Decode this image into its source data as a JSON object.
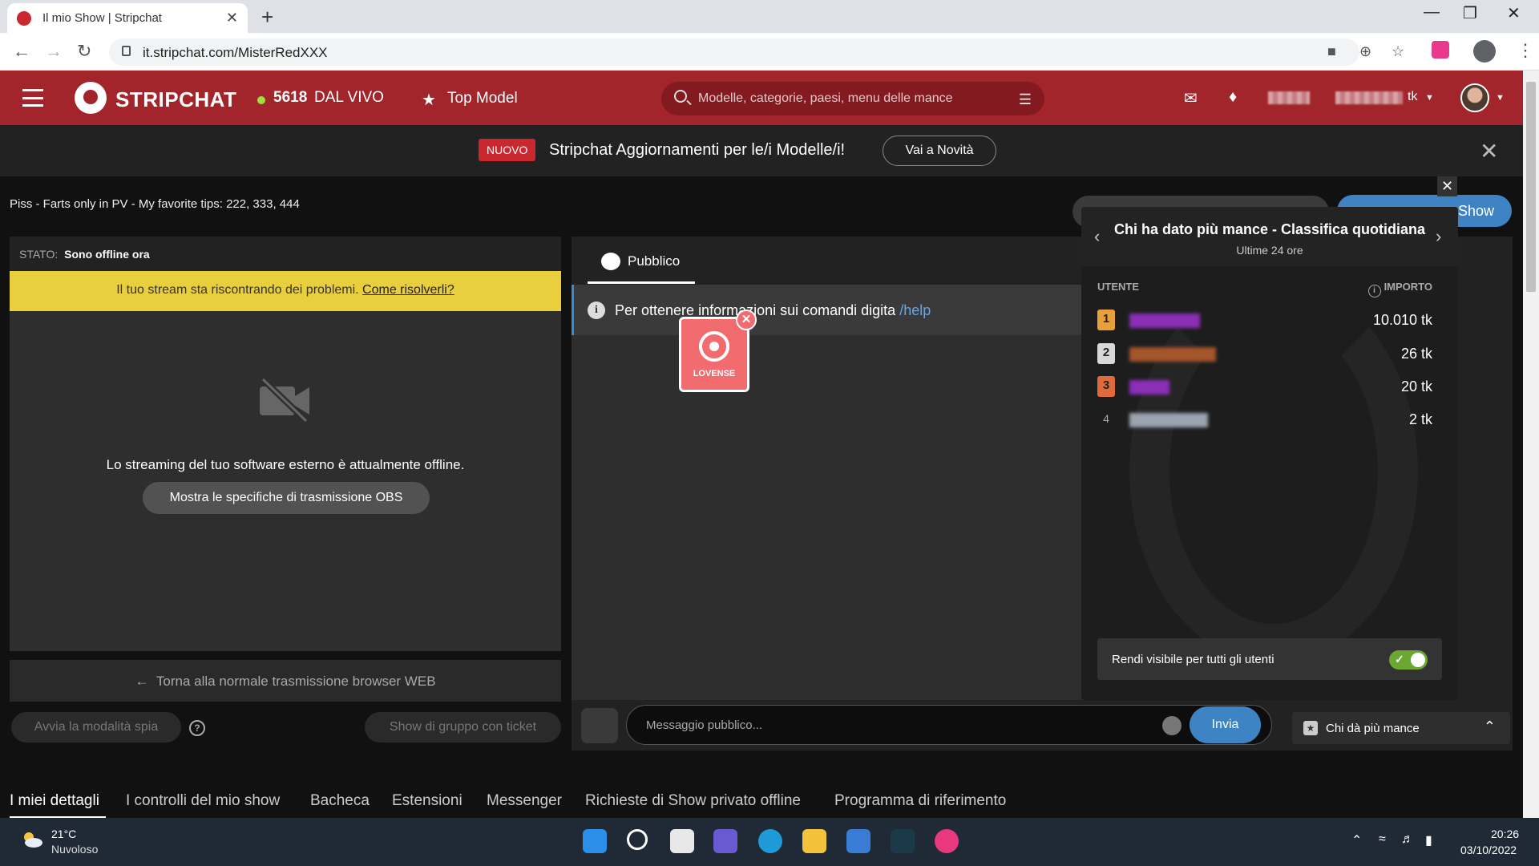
{
  "browser": {
    "tab_title": "Il mio Show | Stripchat",
    "url": "it.stripchat.com/MisterRedXXX",
    "new_tab_glyph": "+",
    "close_glyph": "✕"
  },
  "header": {
    "brand": "STRIPCHAT",
    "live_count": "5618",
    "live_label": "DAL VIVO",
    "top_model": "Top Model",
    "search_placeholder": "Modelle, categorie, paesi, menu delle mance",
    "token_suffix": "tk",
    "icons": [
      "menu-icon",
      "chat-icon",
      "bell-icon",
      "filter-icon",
      "search-icon"
    ]
  },
  "announcement": {
    "badge": "NUOVO",
    "text": "Stripchat Aggiornamenti per le/i Modelle/i!",
    "button": "Vai a Novità"
  },
  "stream": {
    "topic": "Piss - Farts only in PV - My favorite tips: 222, 333, 444",
    "status_key": "STATO:",
    "status_value": "Sono offline ora",
    "warning_text": "Il tuo stream sta riscontrando dei problemi.",
    "warning_link": "Come risolverli?",
    "offline_message": "Lo streaming del tuo software esterno è attualmente offline.",
    "obs_button": "Mostra le specifiche di trasmissione OBS",
    "back_button": "Torna alla normale trasmissione browser WEB",
    "spy_button": "Avvia la modalità spia",
    "group_button": "Show di gruppo con ticket"
  },
  "chat": {
    "tab_label": "Pubblico",
    "info_text": "Per ottenere informazioni sui comandi digita",
    "info_command": "/help",
    "lovense_label": "LOVENSE",
    "input_placeholder": "Messaggio pubblico...",
    "send_button": "Invia"
  },
  "right": {
    "show_button": "Show",
    "tippers_footer": "Chi dà più mance"
  },
  "leaderboard": {
    "title": "Chi ha dato più mance - Classifica quotidiana",
    "subtitle": "Ultime 24 ore",
    "col_user": "UTENTE",
    "col_amount": "IMPORTO",
    "rows": [
      {
        "rank": "1",
        "amount": "10.010 tk",
        "medal_color": "#e8a13a",
        "blur_color": "#8b2fb8"
      },
      {
        "rank": "2",
        "amount": "26 tk",
        "medal_color": "#d8d8d8",
        "blur_color": "#a4552a"
      },
      {
        "rank": "3",
        "amount": "20 tk",
        "medal_color": "#e06a3a",
        "blur_color": "#8b2fb8"
      },
      {
        "rank": "4",
        "amount": "2 tk",
        "medal_color": "",
        "blur_color": "#9aa3b0"
      }
    ],
    "toggle_label": "Rendi visibile per tutti gli utenti",
    "toggle_on": true
  },
  "bottom_nav": [
    "I miei dettagli",
    "I controlli del mio show",
    "Bacheca",
    "Estensioni",
    "Messenger",
    "Richieste di Show privato offline",
    "Programma di riferimento"
  ],
  "taskbar": {
    "temperature": "21°C",
    "weather": "Nuvoloso",
    "time": "20:26",
    "date": "03/10/2022"
  },
  "colors": {
    "brand_red": "#a2252c",
    "accent_blue": "#3e84c4",
    "warning_yellow": "#e9cf3d",
    "live_green": "#9be23c"
  }
}
